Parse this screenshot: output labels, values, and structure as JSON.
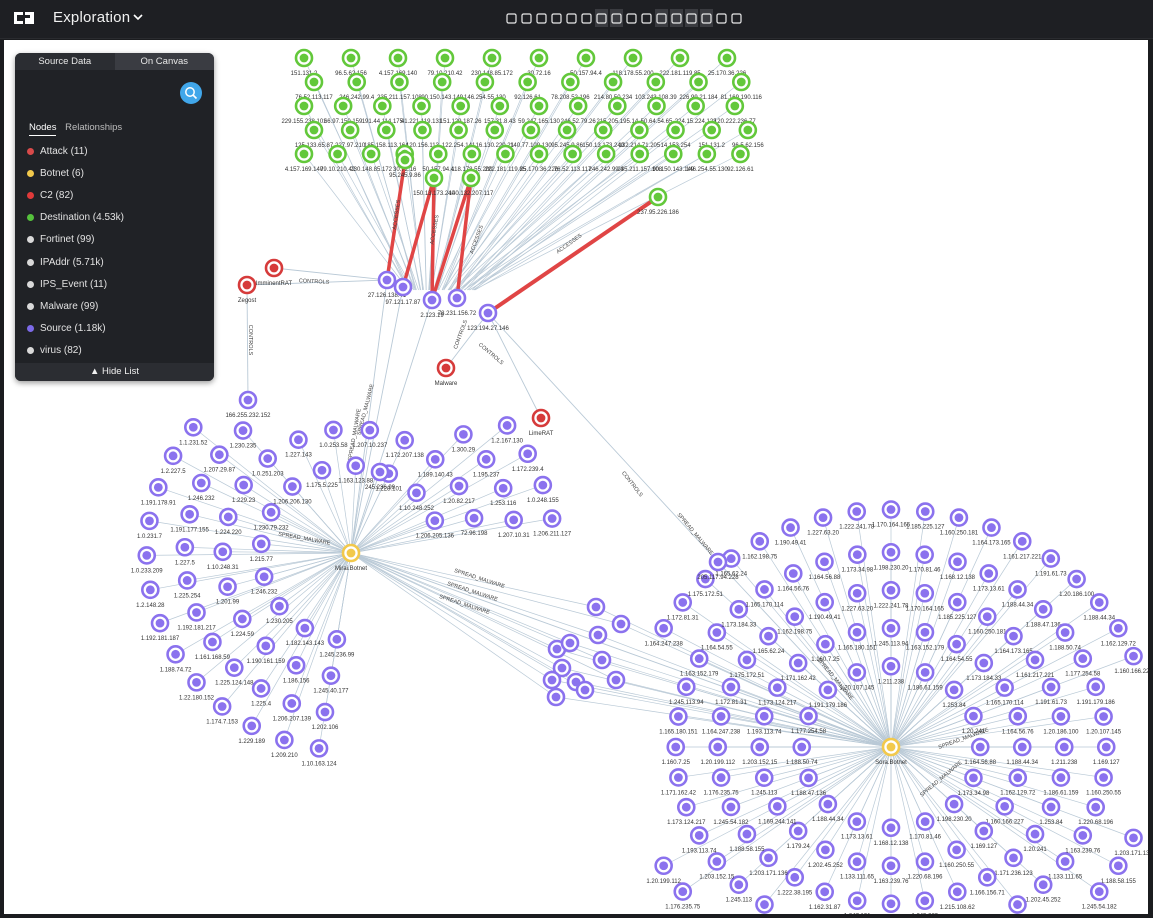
{
  "app": {
    "title": "Exploration"
  },
  "toolbar": {
    "icons": [
      "arrow-left-icon",
      "arrow-right-icon",
      "arrow-left-icon",
      "arrow-right-icon",
      "select-icon",
      "layout-icon",
      "layout-icon",
      "expand-icon",
      "zoom-in-icon",
      "zoom-out-icon",
      "pin-icon",
      "unpin-icon",
      "document-icon",
      "document-icon",
      "settings-icon",
      "settings-icon"
    ]
  },
  "panel": {
    "tabs": {
      "source": "Source Data",
      "canvas": "On Canvas"
    },
    "subtabs": {
      "nodes": "Nodes",
      "relationships": "Relationships"
    },
    "items": [
      {
        "label": "Attack (11)",
        "color": "#d84a4a",
        "icon": "person-icon"
      },
      {
        "label": "Botnet (6)",
        "color": "#f2c94c",
        "icon": "bot-icon"
      },
      {
        "label": "C2 (82)",
        "color": "#e03a3a"
      },
      {
        "label": "Destination (4.53k)",
        "color": "#55c23c"
      },
      {
        "label": "Fortinet (99)",
        "color": "#d9d9d9"
      },
      {
        "label": "IPAddr (5.71k)",
        "color": "#d9d9d9"
      },
      {
        "label": "IPS_Event (11)",
        "color": "#d9d9d9"
      },
      {
        "label": "Malware (99)",
        "color": "#d9d9d9"
      },
      {
        "label": "Source (1.18k)",
        "color": "#7c6ae8"
      },
      {
        "label": "virus (82)",
        "color": "#d9d9d9"
      }
    ],
    "hide_list": "Hide List"
  },
  "graph": {
    "colors": {
      "source": "#8b72ee",
      "destination": "#63c83b",
      "c2": "#d63b3b",
      "botnet": "#f2c94c",
      "edge": "#b9c9d6",
      "accent_edge": "#e04545"
    },
    "named_nodes": [
      {
        "id": "zegost",
        "label": "Zegost",
        "kind": "c2"
      },
      {
        "id": "imminent",
        "label": "ImminentRAT",
        "kind": "c2"
      },
      {
        "id": "malware",
        "label": "Malware",
        "kind": "c2"
      },
      {
        "id": "limerat",
        "label": "LimeRAT",
        "kind": "c2"
      },
      {
        "id": "mirai",
        "label": "Mirai.Botnet",
        "kind": "botnet"
      },
      {
        "id": "sora",
        "label": "Sora.Botnet",
        "kind": "botnet"
      },
      {
        "id": "s1",
        "label": "27.126.138.41",
        "kind": "source"
      },
      {
        "id": "s2",
        "label": "97.121.17.87",
        "kind": "source"
      },
      {
        "id": "s3",
        "label": "2.123.19",
        "kind": "source"
      },
      {
        "id": "s4",
        "label": "78.231.156.72",
        "kind": "source"
      },
      {
        "id": "s5",
        "label": "123.194.27.146",
        "kind": "source"
      },
      {
        "id": "s6",
        "label": "166.255.232.152",
        "kind": "source"
      },
      {
        "id": "s7",
        "label": "205.117.94.228",
        "kind": "source"
      },
      {
        "id": "s8",
        "label": "245.236.99",
        "kind": "source"
      },
      {
        "id": "d1",
        "label": "237.95.226.186",
        "kind": "destination"
      },
      {
        "id": "d2",
        "label": "95.245.9.86",
        "kind": "destination"
      },
      {
        "id": "d3",
        "label": "150.13.173.240",
        "kind": "destination"
      },
      {
        "id": "d4",
        "label": "140.132.207.117",
        "kind": "destination"
      }
    ],
    "edge_labels": {
      "controls": "CONTROLS",
      "accesses": "ACCESSES",
      "spread": "SPREAD_MALWARE"
    },
    "top_labels": [
      "151.131.2",
      "96.5.62.156",
      "4.157.169.140",
      "79.10.210.42",
      "230.148.85.172",
      "30.72.16",
      "50.157.94.4",
      "118.178.55.200",
      "222.181.119.85",
      "25.170.36.226",
      "76.52.113.117",
      "246.242.99.4",
      "235.211.157.108",
      "90.150.143.149",
      "146.254.55.130",
      "92.126.61",
      "78.208.52.196",
      "214.80.50.234",
      "103.243.108.39",
      "226.99.21.184",
      "81.169.190.116",
      "229.155.238.101",
      "66.97.150.159",
      "191.44.114.175",
      "41.221.119.131",
      "151.129.187.26",
      "157.31.8.43",
      "59.247.165.130",
      "246.52.79.26",
      "215.205.195.14",
      "50.64.54.65",
      "224.15.224.123",
      "120.222.236.77",
      "125.133.65.87",
      "227.97.210",
      "185.158.113.164",
      "120.156.113",
      "122.254.141",
      "16.130.220.21",
      "140.77.109.130",
      "95.245.9.86",
      "150.13.173.240",
      "132.214.71.205",
      "14.153.254"
    ],
    "mirai_labels": [
      "1.10.163.124",
      "1.209.210",
      "1.229.189",
      "1.174.7.153",
      "1.22.180.152",
      "1.188.74.72",
      "1.192.181.187",
      "1.2.148.28",
      "1.0.233.209",
      "1.0.231.7",
      "1.191.178.91",
      "1.2.227.5",
      "1.1.231.52",
      "1.2.167.130",
      "1.172.239.4",
      "1.0.248.155",
      "1.206.211.127",
      "1.202.106",
      "1.206.207.139",
      "1.225.4",
      "1.225.124.148",
      "1.161.168.59",
      "1.192.181.217",
      "1.225.254",
      "1.227.5",
      "1.191.177.155",
      "1.246.232",
      "1.207.29.87",
      "1.230.235",
      "1.300.29",
      "1.195.237",
      "1.253.116",
      "1.207.10.31",
      "1.245.40.177",
      "1.186.156",
      "1.190.161.159",
      "1.224.59",
      "1.201.99",
      "1.10.248.31",
      "1.224.220",
      "1.229.23",
      "1.0.251.203",
      "1.227.143",
      "1.0.253.58",
      "1.207.10.237",
      "1.172.207.138",
      "1.189.140.43",
      "1.20.82.217",
      "72.96.198",
      "1.245.236.99",
      "1.182.143.143",
      "1.230.205",
      "1.246.232",
      "1.215.77",
      "1.230.79.232",
      "1.206.206.130",
      "1.175.5.225",
      "1.163.123.88",
      "1.228.101",
      "1.10.248.252",
      "1.206.205.136",
      "1.10.134.248",
      "1.24.177.129",
      "1.204.33.233"
    ],
    "sora_labels": [
      "1.203.171.136",
      "1.188.58.155",
      "1.245.54.182",
      "1.176.235.75",
      "1.20.199.112",
      "1.164.247.238",
      "1.172.81.31",
      "1.175.172.51",
      "1.165.62.24",
      "1.162.198.75",
      "1.190.49.41",
      "1.227.63.20",
      "1.222.241.78",
      "1.170.164.165",
      "1.185.225.127",
      "1.160.250.181",
      "1.164.173.165",
      "1.161.217.221",
      "1.191.61.73",
      "1.20.186.100",
      "1.188.44.34",
      "1.162.129.72",
      "1.160.166.227",
      "1.169.127",
      "1.160.250.55",
      "1.220.68.196",
      "1.163.239.76",
      "1.133.111.65",
      "1.202.45.252",
      "1.179.24",
      "1.169.244.141",
      "1.245.113",
      "1.203.152.15",
      "1.193.113.74",
      "1.173.124.217",
      "1.171.162.42",
      "1.160.7.25",
      "1.165.180.151",
      "1.245.113.94",
      "1.163.152.179",
      "1.164.54.55",
      "1.173.184.33",
      "1.165.170.114",
      "1.164.56.76",
      "1.164.56.88",
      "1.173.34.98",
      "1.198.230.20",
      "1.170.81.46",
      "1.168.12.138",
      "1.173.13.61",
      "1.188.44.34",
      "1.188.47.136",
      "1.188.50.74",
      "1.177.254.58",
      "1.191.179.186",
      "1.20.107.145",
      "1.211.238",
      "1.186.61.159",
      "1.253.84",
      "1.20.241",
      "1.171.236.123",
      "1.166.156.71",
      "1.215.108.62",
      "1.245.229",
      "1.190.22.4",
      "1.247.191",
      "1.162.31.87",
      "1.222.38.195"
    ]
  }
}
